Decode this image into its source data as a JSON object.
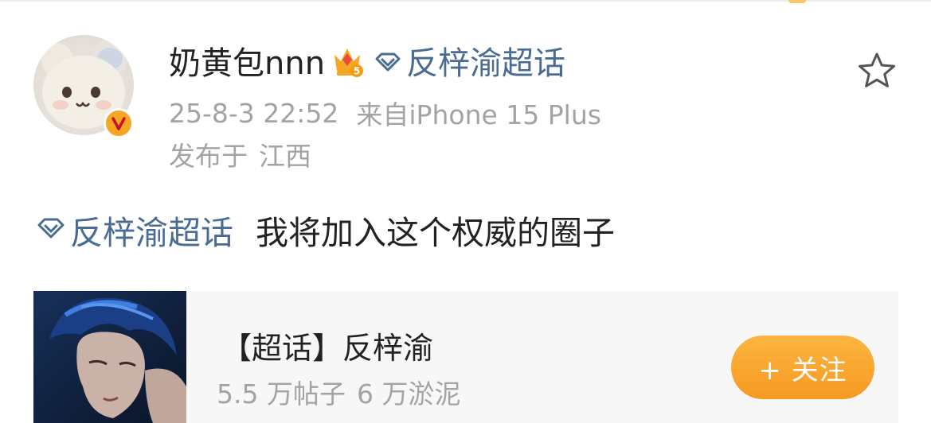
{
  "post": {
    "author": {
      "name": "奶黄包nnn",
      "member_level": "5",
      "verified_badge": "V"
    },
    "topic_tag": "反梓渝超话",
    "timestamp": "25-8-3 22:52",
    "source": "来自iPhone 15 Plus",
    "location_label": "发布于",
    "location_value": "江西",
    "text": {
      "topic": "反梓渝超话",
      "body": "我将加入这个权威的圈子"
    }
  },
  "topic_card": {
    "title": "【超话】反梓渝",
    "posts_count": "5.5 万帖子",
    "mud_count": "6 万淤泥",
    "follow_label": "+ 关注"
  },
  "colors": {
    "topic_link": "#4a6c93",
    "follow_button": "#f5a623",
    "meta_text": "#a3a3a3"
  },
  "icons": {
    "favorite": "star-outline-icon",
    "topic": "gem-icon",
    "member": "crown-icon",
    "verified": "verified-v-icon"
  }
}
